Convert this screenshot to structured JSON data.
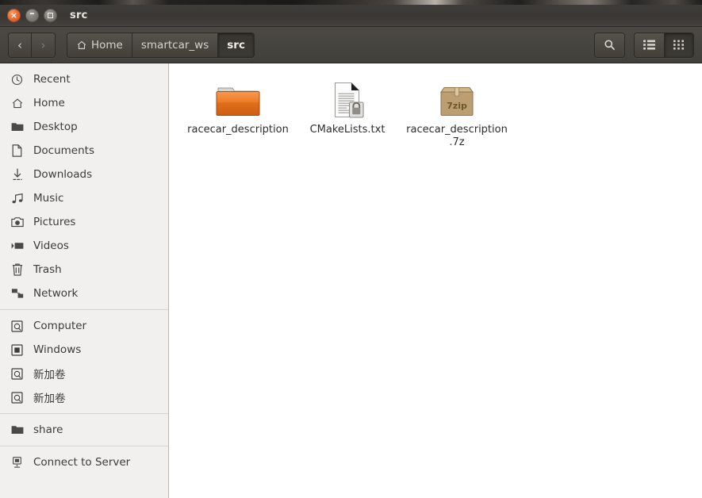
{
  "window": {
    "title": "src",
    "controls": [
      {
        "name": "close",
        "glyph": "×"
      },
      {
        "name": "minimize",
        "glyph": "–"
      },
      {
        "name": "maximize",
        "glyph": ""
      }
    ]
  },
  "toolbar": {
    "back_glyph": "‹",
    "forward_glyph": "›",
    "breadcrumbs": [
      {
        "label": "Home",
        "icon": "home-icon",
        "active": false
      },
      {
        "label": "smartcar_ws",
        "icon": "",
        "active": false
      },
      {
        "label": "src",
        "icon": "",
        "active": true
      }
    ],
    "search_icon": "search-icon",
    "list_view_icon": "list-view-icon",
    "grid_view_icon": "grid-view-icon",
    "active_view": "grid"
  },
  "sidebar": {
    "groups": [
      {
        "items": [
          {
            "label": "Recent",
            "icon": "clock-icon"
          },
          {
            "label": "Home",
            "icon": "home-icon"
          },
          {
            "label": "Desktop",
            "icon": "folder-icon"
          },
          {
            "label": "Documents",
            "icon": "document-icon"
          },
          {
            "label": "Downloads",
            "icon": "download-icon"
          },
          {
            "label": "Music",
            "icon": "music-note-icon"
          },
          {
            "label": "Pictures",
            "icon": "camera-icon"
          },
          {
            "label": "Videos",
            "icon": "video-camera-icon"
          },
          {
            "label": "Trash",
            "icon": "trash-icon"
          },
          {
            "label": "Network",
            "icon": "network-icon"
          }
        ]
      },
      {
        "items": [
          {
            "label": "Computer",
            "icon": "hard-drive-icon"
          },
          {
            "label": "Windows",
            "icon": "drive-windows-icon"
          },
          {
            "label": "新加卷",
            "icon": "hard-drive-icon"
          },
          {
            "label": "新加卷",
            "icon": "hard-drive-icon"
          }
        ]
      },
      {
        "items": [
          {
            "label": "share",
            "icon": "folder-icon"
          }
        ]
      },
      {
        "items": [
          {
            "label": "Connect to Server",
            "icon": "server-connect-icon"
          }
        ]
      }
    ]
  },
  "files": [
    {
      "name": "racecar_description",
      "icon": "folder-orange-icon",
      "type": "folder"
    },
    {
      "name": "CMakeLists.txt",
      "icon": "text-document-locked-icon",
      "type": "file"
    },
    {
      "name": "racecar_description.7z",
      "icon": "archive-7zip-icon",
      "type": "archive",
      "badge_text": "7zip"
    }
  ],
  "colors": {
    "titlebar": "#3a3834",
    "toolbar": "#47453f",
    "sidebar_bg": "#f1f0ee",
    "content_bg": "#ffffff",
    "folder_orange": "#e8761f",
    "archive_tan": "#bfa376",
    "close_button": "#e8703a"
  }
}
